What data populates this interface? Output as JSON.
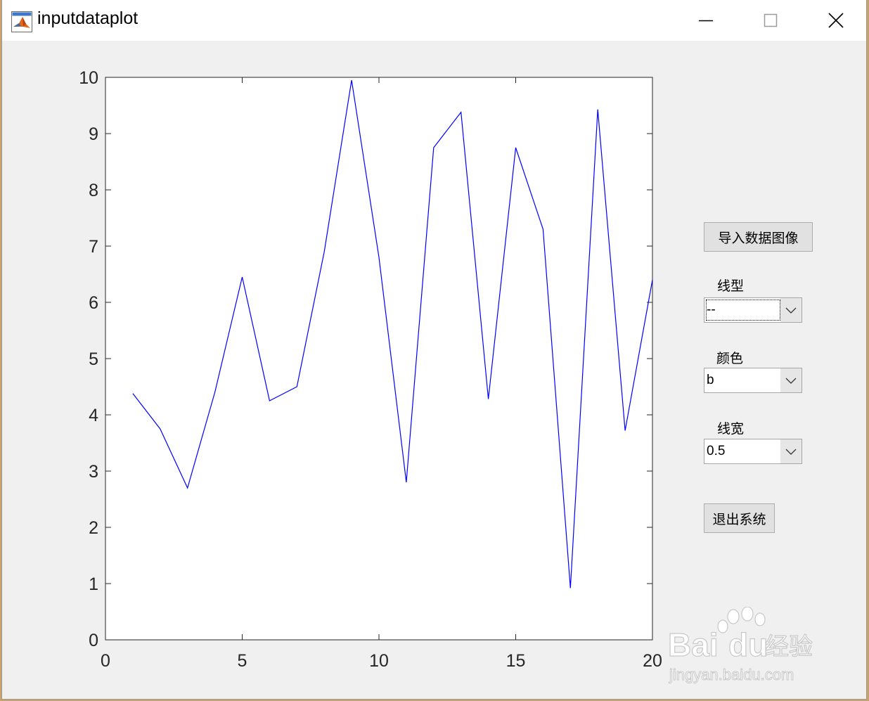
{
  "window": {
    "title": "inputdataplot"
  },
  "controls": {
    "import_button": "导入数据图像",
    "linestyle_label": "线型",
    "linestyle_value": "--",
    "color_label": "颜色",
    "color_value": "b",
    "linewidth_label": "线宽",
    "linewidth_value": "0.5",
    "exit_button": "退出系统"
  },
  "watermark": {
    "brand": "Bai",
    "brand_suffix": "经验",
    "url": "jingyan.baidu.com"
  },
  "colors": {
    "line": "#0000ff",
    "axis": "#262626"
  },
  "chart_data": {
    "type": "line",
    "x": [
      1,
      2,
      3,
      4,
      5,
      6,
      7,
      8,
      9,
      10,
      11,
      12,
      13,
      14,
      15,
      16,
      17,
      18,
      19,
      20
    ],
    "series": [
      {
        "values": [
          4.38,
          3.75,
          2.7,
          4.4,
          6.45,
          4.25,
          4.5,
          6.9,
          9.95,
          6.8,
          2.8,
          8.75,
          9.38,
          4.28,
          8.75,
          7.3,
          0.92,
          9.43,
          3.72,
          6.4
        ]
      }
    ],
    "xlim": [
      0,
      20
    ],
    "ylim": [
      0,
      10
    ],
    "xticks": [
      0,
      5,
      10,
      15,
      20
    ],
    "yticks": [
      0,
      1,
      2,
      3,
      4,
      5,
      6,
      7,
      8,
      9,
      10
    ],
    "grid": false
  }
}
